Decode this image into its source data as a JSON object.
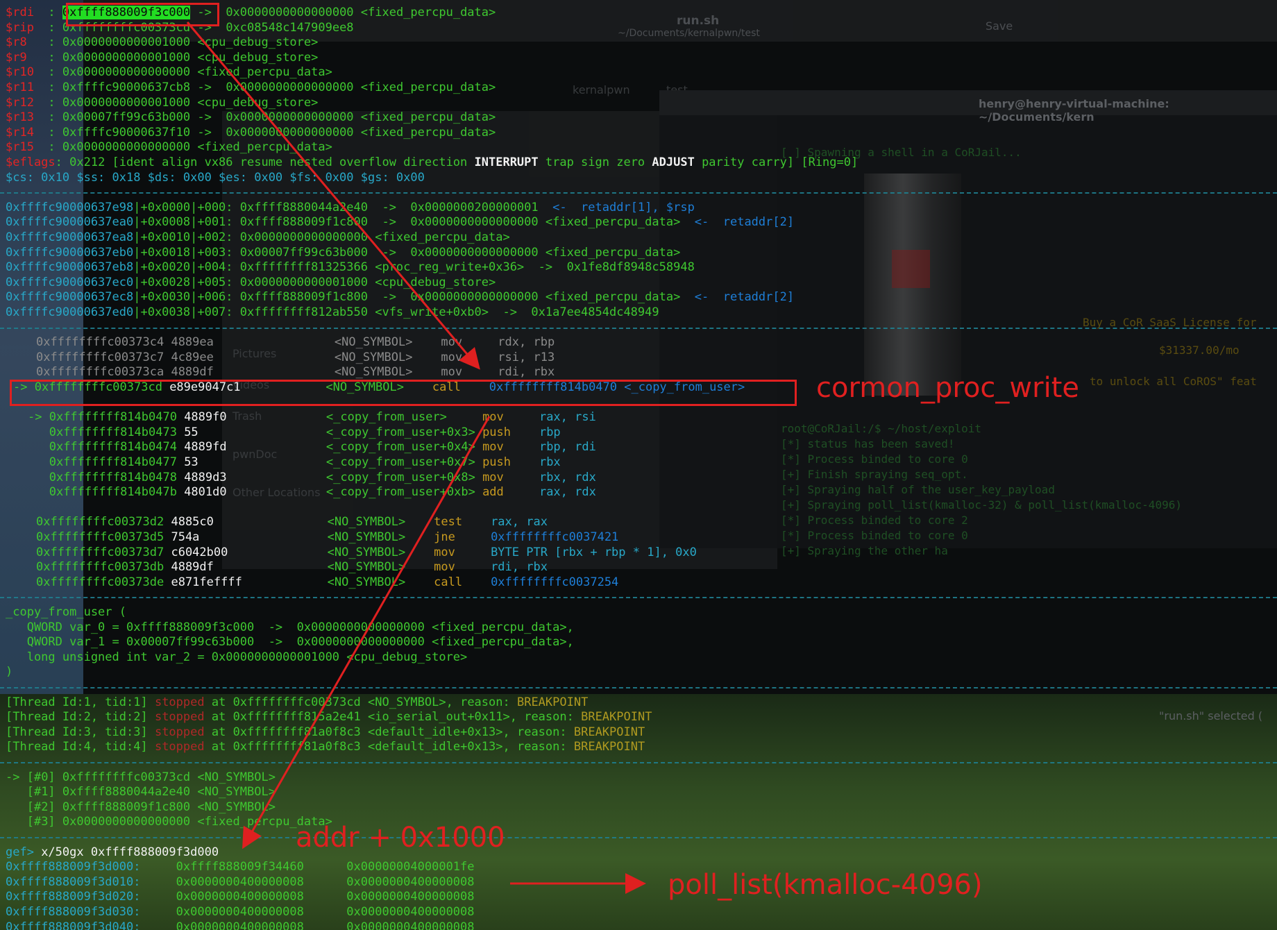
{
  "ghost_ui": {
    "editor_title": "run.sh",
    "editor_path": "~/Documents/kernalpwn/test",
    "editor_save": "Save",
    "tabs": [
      "kernalpwn",
      "test"
    ],
    "terminal_title": "henry@henry-virtual-machine: ~/Documents/kern",
    "sidebar": [
      "Pictures",
      "Videos",
      "Trash",
      "pwnDoc",
      "Other Locations"
    ],
    "status": "\"run.sh\" selected (",
    "terminal_lines": [
      "[ ] Spawning a shell in a CoRJail...",
      "Buy a CoR SaaS License for",
      "$31337.00/mo",
      "to unlock all CoROS\" feat",
      "root@CoRJail:/$ ~/host/exploit",
      "[*] status has been saved!",
      "[*] Process binded to core 0",
      "[+] Finish spraying seq_opt.",
      "[+] Spraying half of the user_key_payload",
      "[+] Spraying poll_list(kmalloc-32) & poll_list(kmalloc-4096)",
      "[*] Process binded to core 2",
      "[*] Process binded to core 0",
      "[+] Spraying the other ha"
    ]
  },
  "registers": [
    {
      "name": "$rdi",
      "val": "0xffff888009f3c000",
      "rest": " ->  0x0000000000000000 <fixed_percpu_data>"
    },
    {
      "name": "$rip",
      "val": "0xffffffffc00373cd",
      "rest": " ->  0xc08548c147909ee8"
    },
    {
      "name": "$r8 ",
      "val": "0x0000000000001000",
      "rest": " <cpu_debug_store>"
    },
    {
      "name": "$r9 ",
      "val": "0x0000000000001000",
      "rest": " <cpu_debug_store>"
    },
    {
      "name": "$r10",
      "val": "0x0000000000000000",
      "rest": " <fixed_percpu_data>"
    },
    {
      "name": "$r11",
      "val": "0xffffc90000637cb8",
      "rest": " ->  0x0000000000000000 <fixed_percpu_data>"
    },
    {
      "name": "$r12",
      "val": "0x0000000000001000",
      "rest": " <cpu_debug_store>"
    },
    {
      "name": "$r13",
      "val": "0x00007ff99c63b000",
      "rest": " ->  0x0000000000000000 <fixed_percpu_data>"
    },
    {
      "name": "$r14",
      "val": "0xffffc90000637f10",
      "rest": " ->  0x0000000000000000 <fixed_percpu_data>"
    },
    {
      "name": "$r15",
      "val": "0x0000000000000000",
      "rest": " <fixed_percpu_data>"
    }
  ],
  "eflags": {
    "label": "$eflags",
    "pre": ": 0x212 [ident align vx86 resume nested overflow direction ",
    "int": "INTERRUPT",
    "mid": " trap sign zero ",
    "adj": "ADJUST",
    "post": " parity carry] [Ring=0]"
  },
  "segments": "$cs: 0x10 $ss: 0x18 $ds: 0x00 $es: 0x00 $fs: 0x00 $gs: 0x00",
  "stack": [
    {
      "addr": "0xffffc90000637e98",
      "off": "|+0x0000|+000:",
      "val": " 0xffff8880044a2e40  ->  0x0000000200000001",
      "tag": "  <-  retaddr[1], $rsp"
    },
    {
      "addr": "0xffffc90000637ea0",
      "off": "|+0x0008|+001:",
      "val": " 0xffff888009f1c800  ->  0x0000000000000000 <fixed_percpu_data>",
      "tag": "  <-  retaddr[2]"
    },
    {
      "addr": "0xffffc90000637ea8",
      "off": "|+0x0010|+002:",
      "val": " 0x0000000000000000 <fixed_percpu_data>",
      "tag": ""
    },
    {
      "addr": "0xffffc90000637eb0",
      "off": "|+0x0018|+003:",
      "val": " 0x00007ff99c63b000  ->  0x0000000000000000 <fixed_percpu_data>",
      "tag": ""
    },
    {
      "addr": "0xffffc90000637eb8",
      "off": "|+0x0020|+004:",
      "val": " 0xffffffff81325366 <proc_reg_write+0x36>  ->  0x1fe8df8948c58948",
      "tag": ""
    },
    {
      "addr": "0xffffc90000637ec0",
      "off": "|+0x0028|+005:",
      "val": " 0x0000000000001000 <cpu_debug_store>",
      "tag": ""
    },
    {
      "addr": "0xffffc90000637ec8",
      "off": "|+0x0030|+006:",
      "val": " 0xffff888009f1c800  ->  0x0000000000000000 <fixed_percpu_data>",
      "tag": "  <-  retaddr[2]"
    },
    {
      "addr": "0xffffc90000637ed0",
      "off": "|+0x0038|+007:",
      "val": " 0xffffffff812ab550 <vfs_write+0xb0>  ->  0x1a7ee4854dc48949",
      "tag": ""
    }
  ],
  "code_pre": [
    {
      "addr": "0xffffffffc00373c4",
      "bytes": "4889ea",
      "sym": "<NO_SYMBOL>",
      "op": "mov",
      "args": "rdx, rbp"
    },
    {
      "addr": "0xffffffffc00373c7",
      "bytes": "4c89ee",
      "sym": "<NO_SYMBOL>",
      "op": "mov",
      "args": "rsi, r13"
    },
    {
      "addr": "0xffffffffc00373ca",
      "bytes": "4889df",
      "sym": "<NO_SYMBOL>",
      "op": "mov",
      "args": "rdi, rbx"
    }
  ],
  "code_cur": {
    "arrow": "-> ",
    "addr": "0xffffffffc00373cd",
    "bytes": "e89e9047c1",
    "sym": "<NO_SYMBOL>",
    "op": "call",
    "target": "0xffffffff814b0470",
    "tsym": " <_copy_from_user>"
  },
  "code_inner": [
    {
      "arrow": "-> ",
      "addr": "0xffffffff814b0470",
      "bytes": "4889f0",
      "sym": "<_copy_from_user>",
      "op": "mov",
      "args": "rax, rsi"
    },
    {
      "arrow": "   ",
      "addr": "0xffffffff814b0473",
      "bytes": "55",
      "sym": "<_copy_from_user+0x3>",
      "op": "push",
      "args": "rbp"
    },
    {
      "arrow": "   ",
      "addr": "0xffffffff814b0474",
      "bytes": "4889fd",
      "sym": "<_copy_from_user+0x4>",
      "op": "mov",
      "args": "rbp, rdi"
    },
    {
      "arrow": "   ",
      "addr": "0xffffffff814b0477",
      "bytes": "53",
      "sym": "<_copy_from_user+0x7>",
      "op": "push",
      "args": "rbx"
    },
    {
      "arrow": "   ",
      "addr": "0xffffffff814b0478",
      "bytes": "4889d3",
      "sym": "<_copy_from_user+0x8>",
      "op": "mov",
      "args": "rbx, rdx"
    },
    {
      "arrow": "   ",
      "addr": "0xffffffff814b047b",
      "bytes": "4801d0",
      "sym": "<_copy_from_user+0xb>",
      "op": "add",
      "args": "rax, rdx"
    }
  ],
  "code_post": [
    {
      "addr": "0xffffffffc00373d2",
      "bytes": "4885c0",
      "sym": "<NO_SYMBOL>",
      "op": "test",
      "args": "rax, rax",
      "argc": "cyan"
    },
    {
      "addr": "0xffffffffc00373d5",
      "bytes": "754a",
      "sym": "<NO_SYMBOL>",
      "op": "jne",
      "args": "0xffffffffc0037421",
      "argc": "bluek"
    },
    {
      "addr": "0xffffffffc00373d7",
      "bytes": "c6042b00",
      "sym": "<NO_SYMBOL>",
      "op": "mov",
      "args": "BYTE PTR [rbx + rbp * 1], 0x0",
      "argc": "cyan"
    },
    {
      "addr": "0xffffffffc00373db",
      "bytes": "4889df",
      "sym": "<NO_SYMBOL>",
      "op": "mov",
      "args": "rdi, rbx",
      "argc": "cyan"
    },
    {
      "addr": "0xffffffffc00373de",
      "bytes": "e871feffff",
      "sym": "<NO_SYMBOL>",
      "op": "call",
      "args": "0xffffffffc0037254",
      "argc": "bluek"
    }
  ],
  "args_block": [
    "_copy_from_user (",
    "   QWORD var_0 = 0xffff888009f3c000  ->  0x0000000000000000 <fixed_percpu_data>,",
    "   QWORD var_1 = 0x00007ff99c63b000  ->  0x0000000000000000 <fixed_percpu_data>,",
    "   long unsigned int var_2 = 0x0000000000001000 <cpu_debug_store>",
    ")"
  ],
  "threads": [
    {
      "id": "[Thread Id:1, tid:1]",
      "addr": "0xffffffffc00373cd <NO_SYMBOL>"
    },
    {
      "id": "[Thread Id:2, tid:2]",
      "addr": "0xffffffff815a2e41 <io_serial_out+0x11>"
    },
    {
      "id": "[Thread Id:3, tid:3]",
      "addr": "0xffffffff81a0f8c3 <default_idle+0x13>"
    },
    {
      "id": "[Thread Id:4, tid:4]",
      "addr": "0xffffffff81a0f8c3 <default_idle+0x13>"
    }
  ],
  "thread_words": {
    "stopped": "stopped",
    "at": " at ",
    "reason": ", reason: ",
    "bp": "BREAKPOINT"
  },
  "frames": [
    {
      "pfx": "-> ",
      "idx": "[#0]",
      "val": " 0xffffffffc00373cd <NO_SYMBOL>"
    },
    {
      "pfx": "   ",
      "idx": "[#1]",
      "val": " 0xffff8880044a2e40 <NO_SYMBOL>"
    },
    {
      "pfx": "   ",
      "idx": "[#2]",
      "val": " 0xffff888009f1c800 <NO_SYMBOL>"
    },
    {
      "pfx": "   ",
      "idx": "[#3]",
      "val": " 0x0000000000000000 <fixed_percpu_data>"
    }
  ],
  "prompt": {
    "p": "gef> ",
    "cmd": "x/50gx 0xffff888009f3d000"
  },
  "dump": [
    {
      "addr": "0xffff888009f3d000:",
      "a": "0xffff888009f34460",
      "b": "0x00000004000001fe"
    },
    {
      "addr": "0xffff888009f3d010:",
      "a": "0x0000000400000008",
      "b": "0x0000000400000008"
    },
    {
      "addr": "0xffff888009f3d020:",
      "a": "0x0000000400000008",
      "b": "0x0000000400000008"
    },
    {
      "addr": "0xffff888009f3d030:",
      "a": "0x0000000400000008",
      "b": "0x0000000400000008"
    },
    {
      "addr": "0xffff888009f3d040:",
      "a": "0x0000000400000008",
      "b": "0x0000000400000008"
    }
  ],
  "annotations": {
    "call_label": "cormon_proc_write",
    "addr_label": "addr + 0x1000",
    "poll_label": "poll_list(kmalloc-4096)"
  },
  "colors": {
    "accent_red": "#e02020",
    "term_green": "#3fc830",
    "highlight": "#22dd22"
  }
}
